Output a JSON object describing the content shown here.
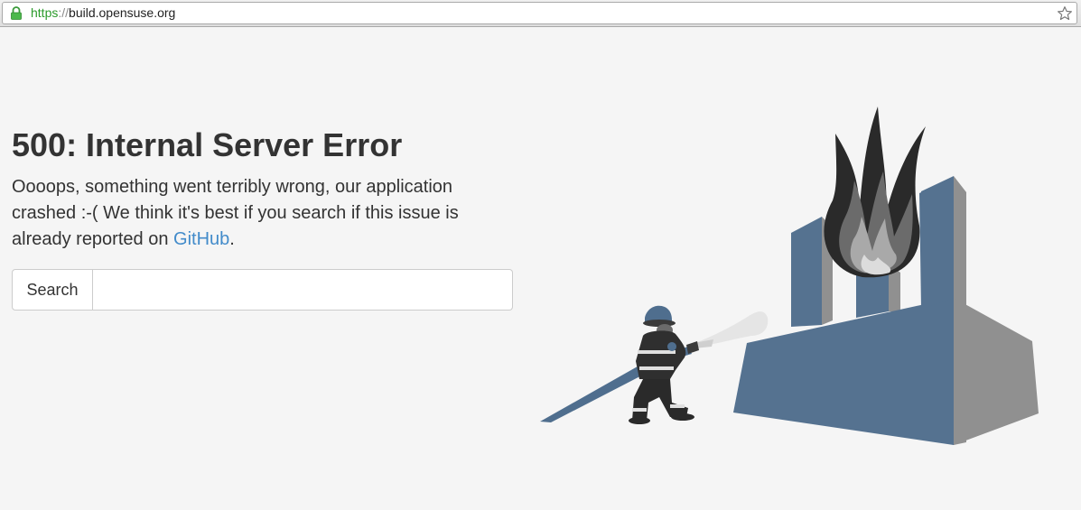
{
  "browser": {
    "url_scheme": "https",
    "url_separator": "://",
    "url_host": "build.opensuse.org",
    "lock_icon": "lock-icon",
    "bookmark_icon": "star-icon"
  },
  "error": {
    "title": "500: Internal Server Error",
    "message_part1": "Oooops, something went terribly wrong, our application crashed :-( We think it's best if you search if this issue is already reported on ",
    "github_link": "GitHub",
    "message_end": "."
  },
  "search": {
    "button_label": "Search",
    "value": "",
    "placeholder": ""
  },
  "illustration": {
    "subject": "firefighter-extinguishing-burning-factory",
    "colors": {
      "building_front": "#557290",
      "building_side": "#909090",
      "hose": "#4f6e8e",
      "flame_dark": "#2a2a2a"
    }
  }
}
